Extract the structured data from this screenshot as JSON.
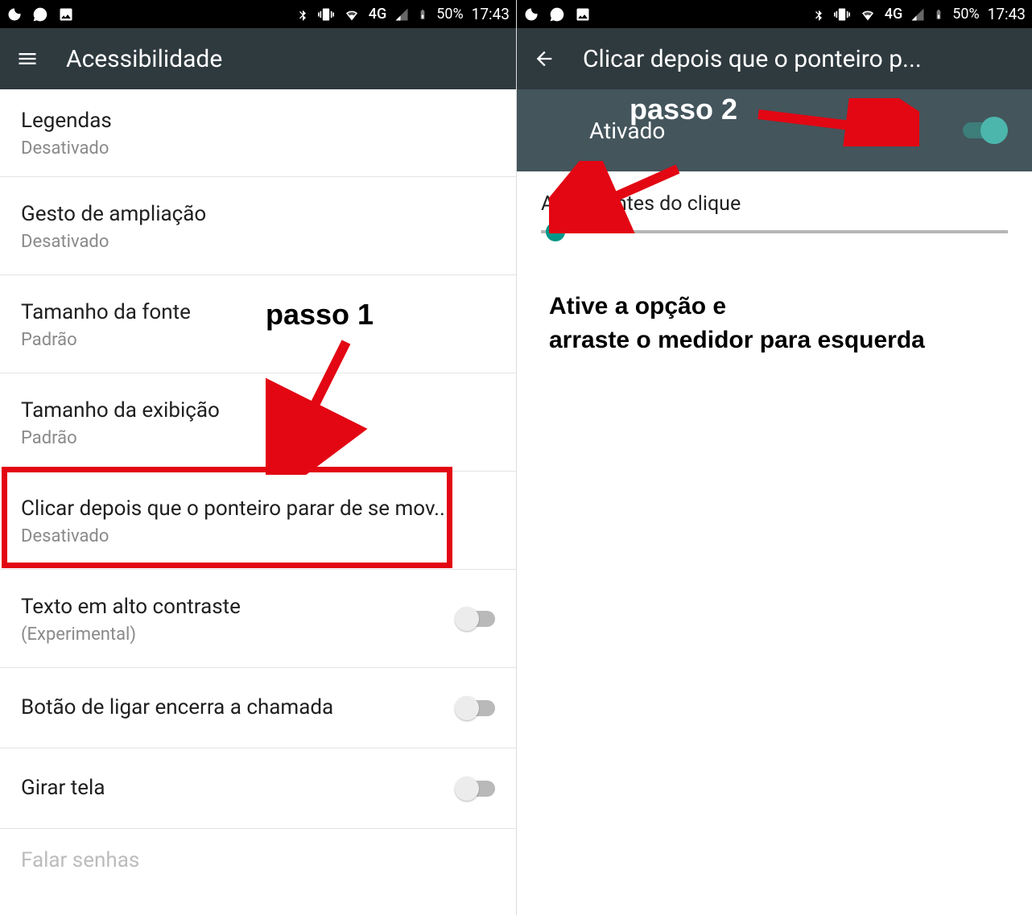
{
  "statusbar": {
    "battery_text": "50%",
    "time": "17:43",
    "network": "4G"
  },
  "left": {
    "app_title": "Acessibilidade",
    "items": [
      {
        "title": "Legendas",
        "sub": "Desativado"
      },
      {
        "title": "Gesto de ampliação",
        "sub": "Desativado"
      },
      {
        "title": "Tamanho da fonte",
        "sub": "Padrão"
      },
      {
        "title": "Tamanho da exibição",
        "sub": "Padrão"
      },
      {
        "title": "Clicar depois que o ponteiro parar de se mov..",
        "sub": "Desativado"
      },
      {
        "title": "Texto em alto contraste",
        "sub": "(Experimental)",
        "toggle": true
      },
      {
        "title": "Botão de ligar encerra a chamada",
        "toggle": true
      },
      {
        "title": "Girar tela",
        "toggle": true
      },
      {
        "title": "Falar senhas"
      }
    ]
  },
  "right": {
    "app_title": "Clicar depois que o ponteiro p...",
    "status_text": "Ativado",
    "slider_label": "Atraso antes do clique"
  },
  "annotations": {
    "step1": "passo 1",
    "step2": "passo 2",
    "instruction_line1": "Ative a opção e",
    "instruction_line2": "arraste o medidor para esquerda"
  },
  "colors": {
    "accent_red": "#e30613",
    "teal": "#009688",
    "teal_light": "#4db6ac",
    "appbar_bg": "#2f3a3f",
    "panel_bg": "#44555c"
  }
}
